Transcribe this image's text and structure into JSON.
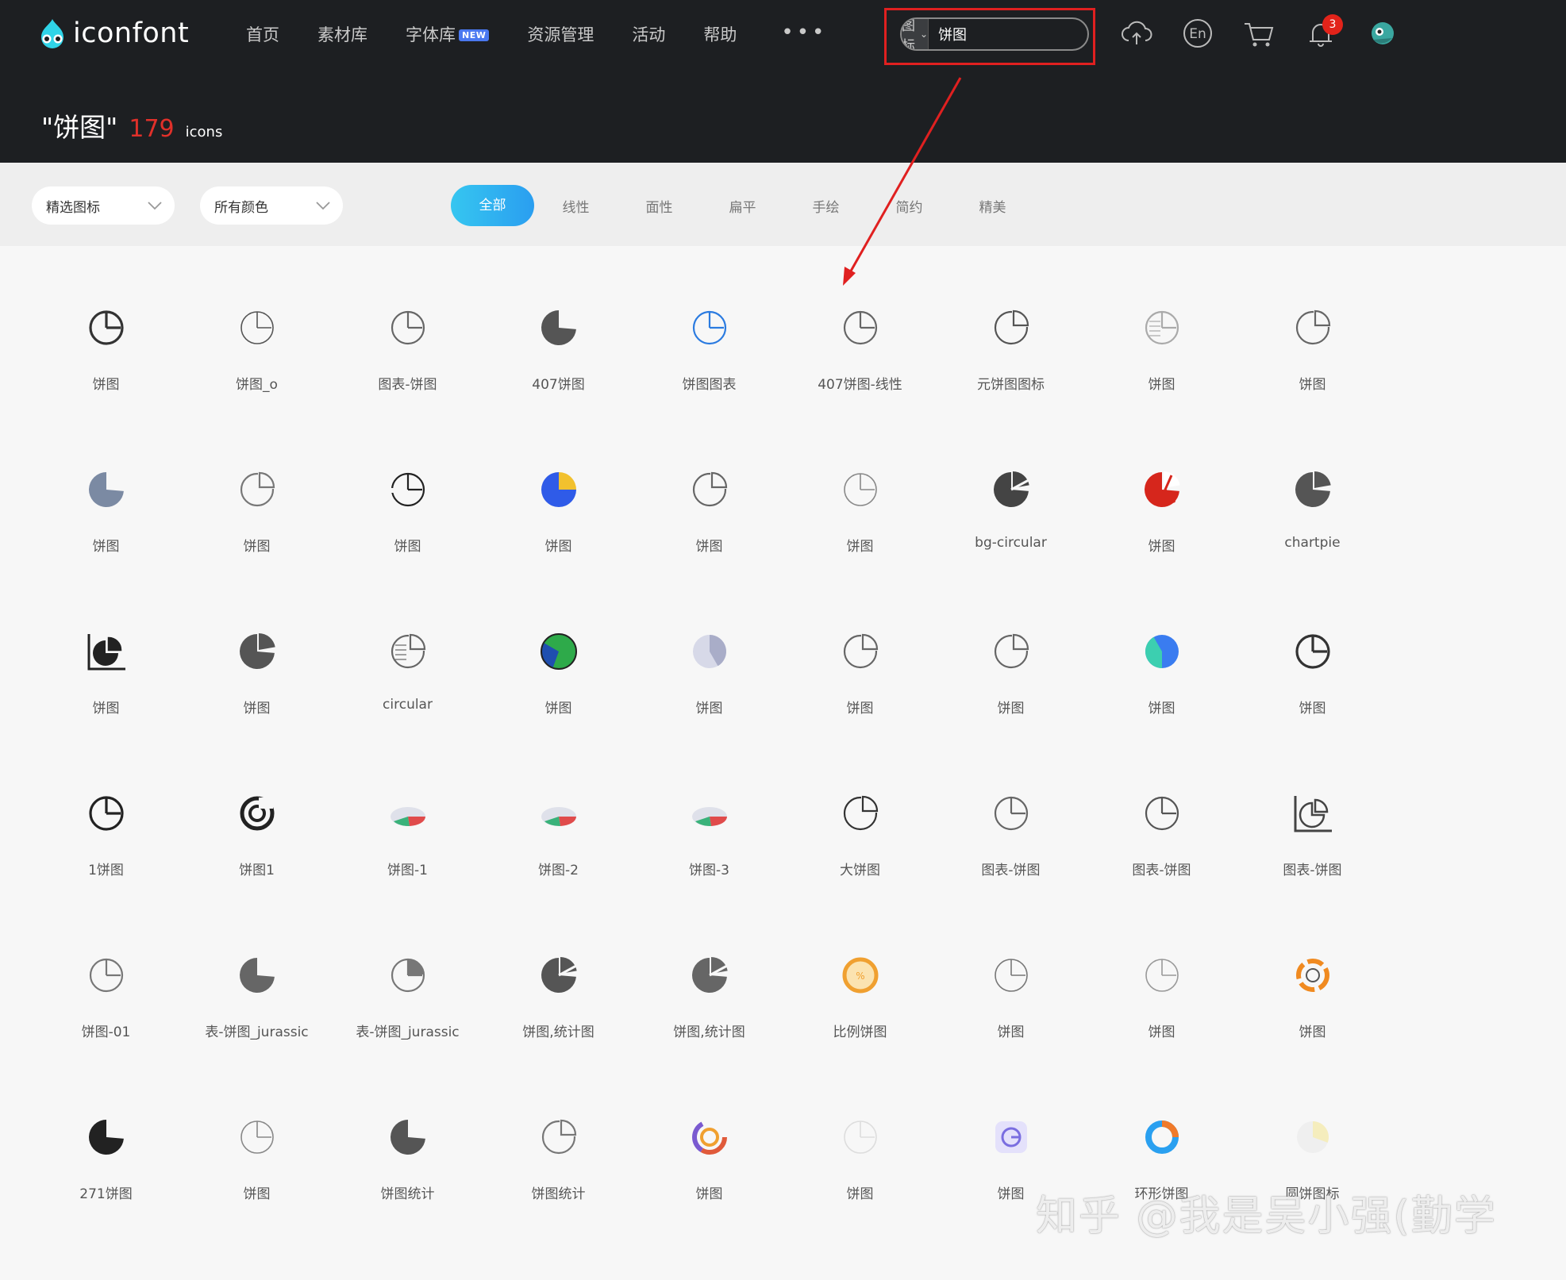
{
  "header": {
    "logo_text": "iconfont",
    "nav": [
      {
        "label": "首页"
      },
      {
        "label": "素材库"
      },
      {
        "label": "字体库",
        "badge": "NEW"
      },
      {
        "label": "资源管理"
      },
      {
        "label": "活动"
      },
      {
        "label": "帮助"
      }
    ],
    "more_label": "•••",
    "search": {
      "type_label": "图标",
      "value": "饼图"
    },
    "language_label": "En",
    "notification_count": "3"
  },
  "result": {
    "query": "\"饼图\"",
    "count": "179",
    "unit": "icons"
  },
  "filters": {
    "dropdowns": [
      {
        "label": "精选图标"
      },
      {
        "label": "所有颜色"
      }
    ],
    "tabs": [
      {
        "label": "全部",
        "active": true
      },
      {
        "label": "线性"
      },
      {
        "label": "面性"
      },
      {
        "label": "扁平"
      },
      {
        "label": "手绘"
      },
      {
        "label": "简约"
      },
      {
        "label": "精美"
      }
    ]
  },
  "icons": [
    {
      "label": "饼图",
      "icon": "pie-outline-bold-icon",
      "color": "#333333"
    },
    {
      "label": "饼图_o",
      "icon": "pie-outline-thin-icon",
      "color": "#555555"
    },
    {
      "label": "图表-饼图",
      "icon": "pie-outline-icon",
      "color": "#666666"
    },
    {
      "label": "407饼图",
      "icon": "pie-filled-icon",
      "color": "#555555"
    },
    {
      "label": "饼图图表",
      "icon": "pie-outline-blue-icon",
      "color": "#2b7be0"
    },
    {
      "label": "407饼图-线性",
      "icon": "pie-outline-icon",
      "color": "#666666"
    },
    {
      "label": "元饼图图标",
      "icon": "pie-wedge-outline-icon",
      "color": "#555555"
    },
    {
      "label": "饼图",
      "icon": "pie-lined-light-icon",
      "color": "#aaaaaa"
    },
    {
      "label": "饼图",
      "icon": "pie-exploded-outline-icon",
      "color": "#666666"
    },
    {
      "label": "饼图",
      "icon": "pie-filled-slate-icon",
      "color": "#7b8aa3"
    },
    {
      "label": "饼图",
      "icon": "pie-exploded-outline-icon",
      "color": "#777777"
    },
    {
      "label": "饼图",
      "icon": "pie-broken-outline-icon",
      "color": "#222222"
    },
    {
      "label": "饼图",
      "icon": "pie-blue-yellow-icon",
      "color": "#2f5be8"
    },
    {
      "label": "饼图",
      "icon": "pie-exploded-outline-icon",
      "color": "#666666"
    },
    {
      "label": "饼图",
      "icon": "pie-outline-thin-icon",
      "color": "#888888"
    },
    {
      "label": "bg-circular",
      "icon": "pie-split-filled-icon",
      "color": "#444444"
    },
    {
      "label": "饼图",
      "icon": "pie-red-filled-icon",
      "color": "#d6261c"
    },
    {
      "label": "chartpie",
      "icon": "pie-filled-gap-icon",
      "color": "#555555"
    },
    {
      "label": "饼图",
      "icon": "pie-chart-axis-icon",
      "color": "#222222"
    },
    {
      "label": "饼图",
      "icon": "pie-filled-gap-icon",
      "color": "#555555"
    },
    {
      "label": "circular",
      "icon": "pie-exploded-lined-icon",
      "color": "#666666"
    },
    {
      "label": "饼图",
      "icon": "pie-green-blue-icon",
      "color": "#2eaa4a"
    },
    {
      "label": "饼图",
      "icon": "pie-lavender-icon",
      "color": "#b9bdd6"
    },
    {
      "label": "饼图",
      "icon": "pie-exploded-outline-icon",
      "color": "#666666"
    },
    {
      "label": "饼图",
      "icon": "pie-exploded-outline-small-icon",
      "color": "#666666"
    },
    {
      "label": "饼图",
      "icon": "pie-blue-teal-icon",
      "color": "#3a7cf0"
    },
    {
      "label": "饼图",
      "icon": "pie-outline-bold-icon",
      "color": "#333333"
    },
    {
      "label": "1饼图",
      "icon": "pie-outline-bold-icon",
      "color": "#222222"
    },
    {
      "label": "饼图1",
      "icon": "pie-ring-bold-icon",
      "color": "#222222"
    },
    {
      "label": "饼图-1",
      "icon": "pie-3d-flat-icon",
      "color": "#3ab27a"
    },
    {
      "label": "饼图-2",
      "icon": "pie-3d-tilt-icon",
      "color": "#e04b4b"
    },
    {
      "label": "饼图-3",
      "icon": "pie-3d-tilt-icon",
      "color": "#3ab27a"
    },
    {
      "label": "大饼图",
      "icon": "pie-exploded-outline-icon",
      "color": "#333333"
    },
    {
      "label": "图表-饼图",
      "icon": "pie-outline-icon",
      "color": "#666666"
    },
    {
      "label": "图表-饼图",
      "icon": "pie-outline-icon",
      "color": "#555555"
    },
    {
      "label": "图表-饼图",
      "icon": "pie-chart-axis-outline-icon",
      "color": "#444444"
    },
    {
      "label": "饼图-01",
      "icon": "pie-outline-icon",
      "color": "#777777"
    },
    {
      "label": "表-饼图_jurassic",
      "icon": "pie-filled-icon",
      "color": "#666666"
    },
    {
      "label": "表-饼图_jurassic",
      "icon": "pie-outline-filled-slice-icon",
      "color": "#777777"
    },
    {
      "label": "饼图,统计图",
      "icon": "pie-split-filled-icon",
      "color": "#555555"
    },
    {
      "label": "饼图,统计图",
      "icon": "pie-split-outline-icon",
      "color": "#666666"
    },
    {
      "label": "比例饼图",
      "icon": "pie-orange-percent-icon",
      "color": "#f0a030"
    },
    {
      "label": "饼图",
      "icon": "pie-outline-thin-icon",
      "color": "#777777"
    },
    {
      "label": "饼图",
      "icon": "pie-outline-thin-icon",
      "color": "#999999"
    },
    {
      "label": "饼图",
      "icon": "pie-orange-segments-icon",
      "color": "#f08a20"
    },
    {
      "label": "271饼图",
      "icon": "pie-filled-icon",
      "color": "#222222"
    },
    {
      "label": "饼图",
      "icon": "pie-outline-thin-icon",
      "color": "#888888"
    },
    {
      "label": "饼图统计",
      "icon": "pie-filled-icon",
      "color": "#555555"
    },
    {
      "label": "饼图统计",
      "icon": "pie-exploded-outline-icon",
      "color": "#777777"
    },
    {
      "label": "饼图",
      "icon": "pie-multicolor-ring-icon",
      "color": "#e05a3a"
    },
    {
      "label": "饼图",
      "icon": "pie-faint-outline-icon",
      "color": "#dddddd"
    },
    {
      "label": "饼图",
      "icon": "pie-purple-box-icon",
      "color": "#7a6ee0"
    },
    {
      "label": "环形饼图",
      "icon": "pie-donut-blue-orange-icon",
      "color": "#2aa0f0"
    },
    {
      "label": "圆饼图标",
      "icon": "pie-faint-yellow-icon",
      "color": "#e8e0a8"
    }
  ],
  "watermark": "知乎 @我是吴小强(勤学"
}
